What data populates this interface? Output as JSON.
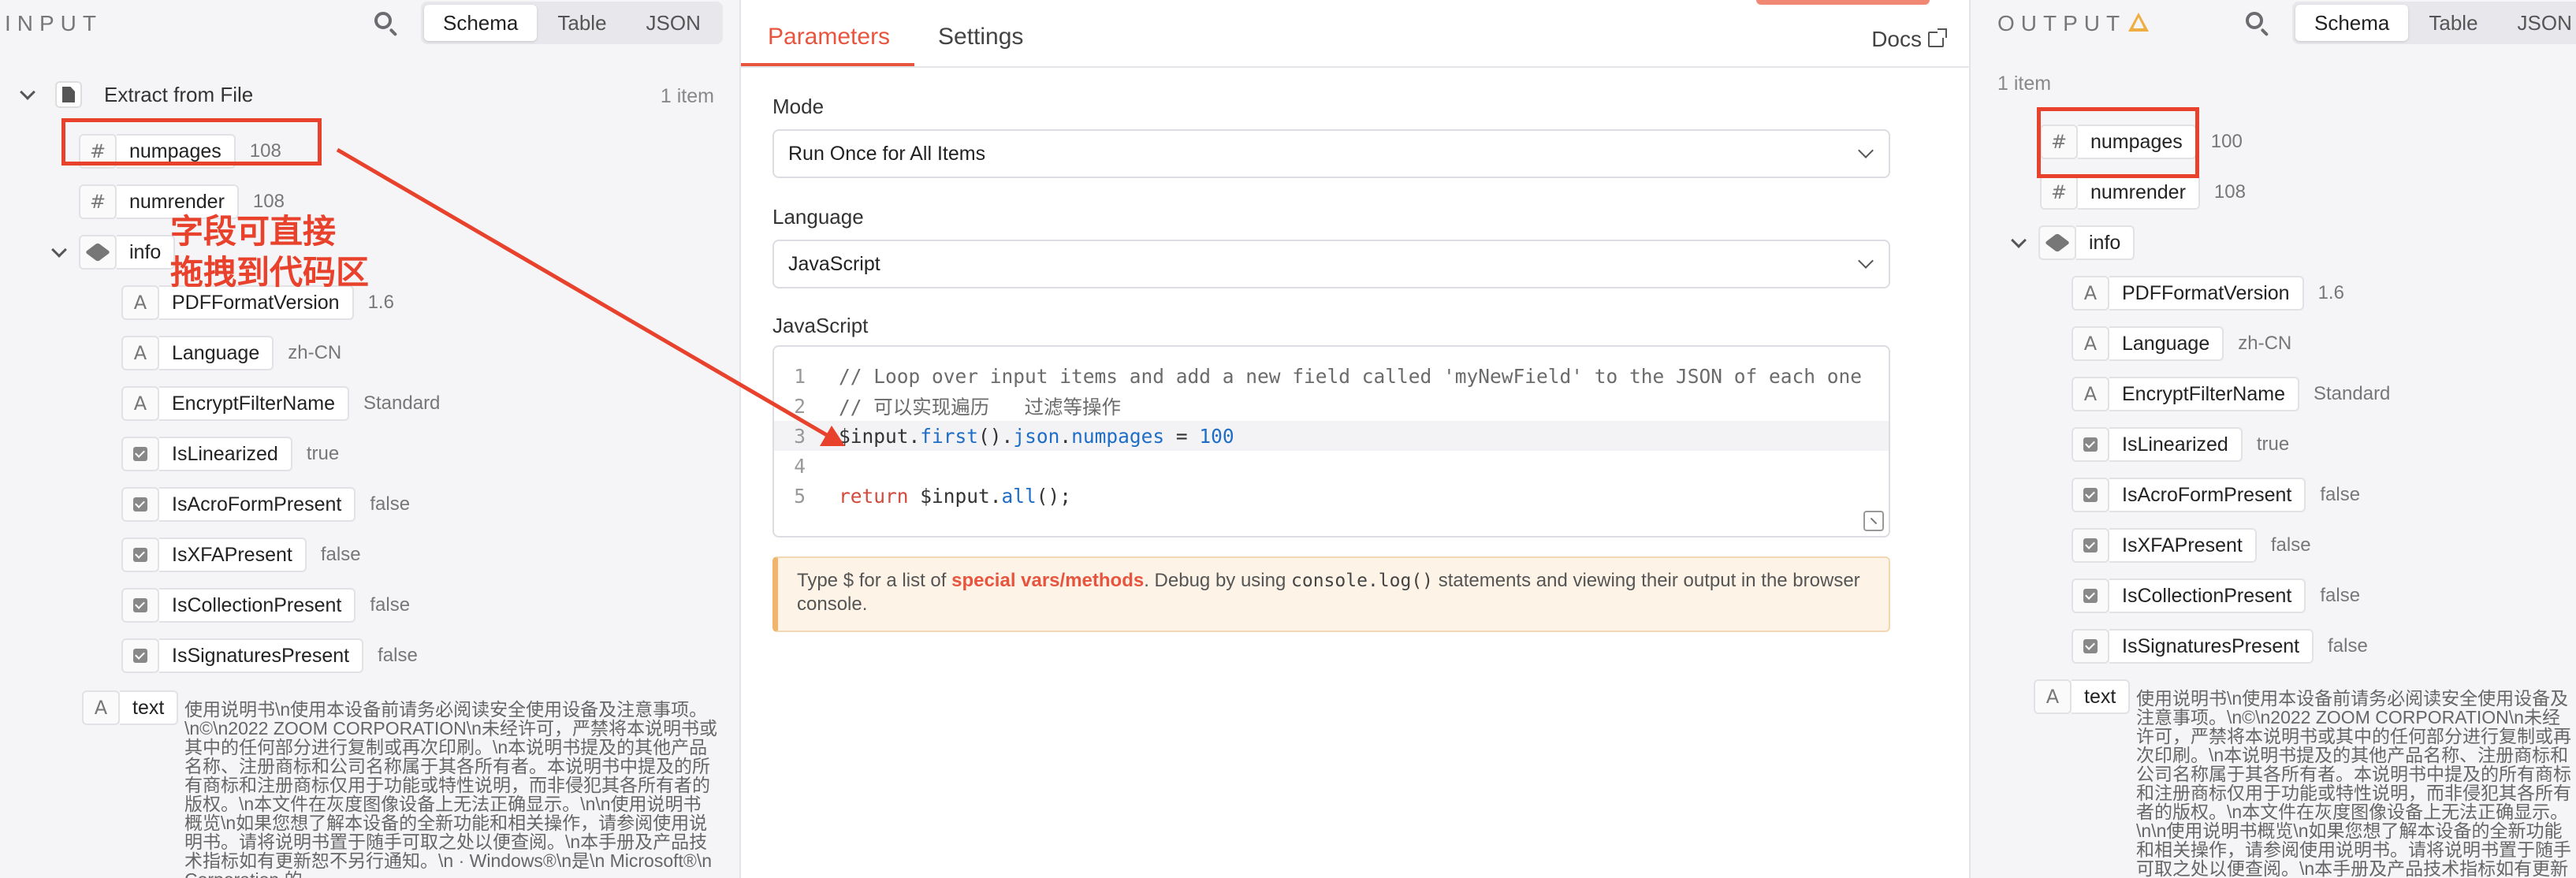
{
  "input": {
    "title": "INPUT",
    "view_tabs": [
      "Schema",
      "Table",
      "JSON"
    ],
    "node_name": "Extract from File",
    "item_count": "1 item",
    "fields": {
      "numpages": {
        "key": "numpages",
        "value": "108"
      },
      "numrender": {
        "key": "numrender",
        "value": "108"
      },
      "info": {
        "key": "info"
      },
      "PDFFormatVersion": {
        "key": "PDFFormatVersion",
        "value": "1.6"
      },
      "Language": {
        "key": "Language",
        "value": "zh-CN"
      },
      "EncryptFilterName": {
        "key": "EncryptFilterName",
        "value": "Standard"
      },
      "IsLinearized": {
        "key": "IsLinearized",
        "value": "true"
      },
      "IsAcroFormPresent": {
        "key": "IsAcroFormPresent",
        "value": "false"
      },
      "IsXFAPresent": {
        "key": "IsXFAPresent",
        "value": "false"
      },
      "IsCollectionPresent": {
        "key": "IsCollectionPresent",
        "value": "false"
      },
      "IsSignaturesPresent": {
        "key": "IsSignaturesPresent",
        "value": "false"
      },
      "text": {
        "key": "text",
        "value": "使用说明书\\n使用本设备前请务必阅读安全使用设备及注意事项。\\n©\\n2022 ZOOM CORPORATION\\n未经许可，严禁将本说明书或其中的任何部分进行复制或再次印刷。\\n本说明书提及的其他产品名称、注册商标和公司名称属于其各所有者。本说明书中提及的所有商标和注册商标仅用于功能或特性说明，而非侵犯其各所有者的版权。\\n本文件在灰度图像设备上无法正确显示。\\n\\n使用说明书概览\\n如果您想了解本设备的全新功能和相关操作，请参阅使用说明书。请将说明书置于随手可取之处以便查阅。\\n本手册及产品技术指标如有更新恕不另行通知。\\n · Windows®\\n是\\n Microsoft®\\n Corporation 的"
      }
    }
  },
  "annotation": {
    "line1": "字段可直接",
    "line2": "拖拽到代码区"
  },
  "center": {
    "tabs": [
      "Parameters",
      "Settings"
    ],
    "docs_label": "Docs",
    "mode_label": "Mode",
    "mode_value": "Run Once for All Items",
    "language_label": "Language",
    "language_value": "JavaScript",
    "code_label": "JavaScript",
    "code_lines": [
      {
        "n": "1",
        "comment": "// Loop over input items and add a new field called 'myNewField' to the JSON of each one"
      },
      {
        "n": "2",
        "comment": "// 可以实现遍历   过滤等操作"
      },
      {
        "n": "3",
        "var": "$input",
        "dot1": ".",
        "fn1": "first",
        "paren1": "().",
        "prop1": "json",
        "dot2": ".",
        "prop2": "numpages",
        "eq": " = ",
        "num": "100"
      },
      {
        "n": "4"
      },
      {
        "n": "5",
        "kw": "return",
        "rest1": " $input.",
        "fn2": "all",
        "rest2": "();"
      }
    ],
    "hint": {
      "prefix": "Type $ for a list of ",
      "link": "special vars/methods",
      "mid": ". Debug by using ",
      "code": "console.log()",
      "suffix": " statements and viewing their output in the browser console."
    }
  },
  "output": {
    "title": "OUTPUT",
    "view_tabs": [
      "Schema",
      "Table",
      "JSON"
    ],
    "item_count": "1 item",
    "fields": {
      "numpages": {
        "key": "numpages",
        "value": "100"
      },
      "numrender": {
        "key": "numrender",
        "value": "108"
      },
      "info": {
        "key": "info"
      },
      "PDFFormatVersion": {
        "key": "PDFFormatVersion",
        "value": "1.6"
      },
      "Language": {
        "key": "Language",
        "value": "zh-CN"
      },
      "EncryptFilterName": {
        "key": "EncryptFilterName",
        "value": "Standard"
      },
      "IsLinearized": {
        "key": "IsLinearized",
        "value": "true"
      },
      "IsAcroFormPresent": {
        "key": "IsAcroFormPresent",
        "value": "false"
      },
      "IsXFAPresent": {
        "key": "IsXFAPresent",
        "value": "false"
      },
      "IsCollectionPresent": {
        "key": "IsCollectionPresent",
        "value": "false"
      },
      "IsSignaturesPresent": {
        "key": "IsSignaturesPresent",
        "value": "false"
      },
      "text": {
        "key": "text",
        "value": "使用说明书\\n使用本设备前请务必阅读安全使用设备及注意事项。\\n©\\n2022 ZOOM CORPORATION\\n未经许可，严禁将本说明书或其中的任何部分进行复制或再次印刷。\\n本说明书提及的其他产品名称、注册商标和公司名称属于其各所有者。本说明书中提及的所有商标和注册商标仅用于功能或特性说明，而非侵犯其各所有者的版权。\\n本文件在灰度图像设备上无法正确显示。\\n\\n使用说明书概览\\n如果您想了解本设备的全新功能和相关操作，请参阅使用说明书。请将说明书置于随手可取之处以便查阅。\\n本手册及产品技术指标如有更新恕不另行通知。\\n · Windows®\\n是\\n Microsoft®\\n Corporation 的商标或注册商标。"
      }
    }
  },
  "colors": {
    "accent": "#e8553f",
    "annotation": "#e8412c",
    "warning": "#f0ae42"
  }
}
